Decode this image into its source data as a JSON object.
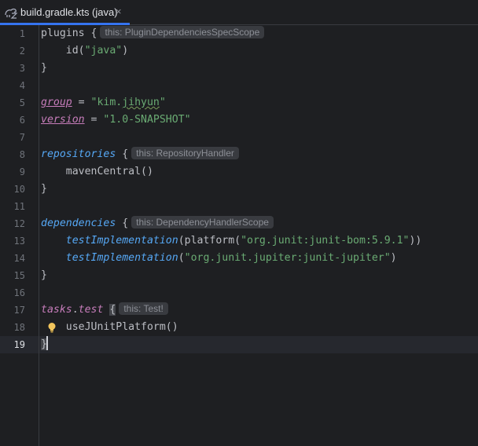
{
  "tab": {
    "label": "build.gradle.kts (java)",
    "close": "×"
  },
  "lines": [
    {
      "n": "1"
    },
    {
      "n": "2"
    },
    {
      "n": "3"
    },
    {
      "n": "4"
    },
    {
      "n": "5"
    },
    {
      "n": "6"
    },
    {
      "n": "7"
    },
    {
      "n": "8"
    },
    {
      "n": "9"
    },
    {
      "n": "10"
    },
    {
      "n": "11"
    },
    {
      "n": "12"
    },
    {
      "n": "13"
    },
    {
      "n": "14"
    },
    {
      "n": "15"
    },
    {
      "n": "16"
    },
    {
      "n": "17"
    },
    {
      "n": "18"
    },
    {
      "n": "19"
    }
  ],
  "code": {
    "l1_plugins": "plugins",
    "l1_brace": " {",
    "l1_hint": "this: PluginDependenciesSpecScope",
    "l2_id": "    id(",
    "l2_str": "\"java\"",
    "l2_close": ")",
    "l3": "}",
    "l5_group": "group",
    "l5_eq": " = ",
    "l5_str_a": "\"kim.",
    "l5_str_b": "jihyun",
    "l5_str_c": "\"",
    "l6_version": "version",
    "l6_eq": " = ",
    "l6_str": "\"1.0-SNAPSHOT\"",
    "l8_repos": "repositories",
    "l8_brace": " {",
    "l8_hint": "this: RepositoryHandler",
    "l9": "    mavenCentral()",
    "l10": "}",
    "l12_deps": "dependencies",
    "l12_brace": " {",
    "l12_hint": "this: DependencyHandlerScope",
    "l13_indent": "    ",
    "l13_fn": "testImplementation",
    "l13_a": "(platform(",
    "l13_str": "\"org.junit:junit-bom:5.9.1\"",
    "l13_b": "))",
    "l14_indent": "    ",
    "l14_fn": "testImplementation",
    "l14_a": "(",
    "l14_str": "\"org.junit.jupiter:junit-jupiter\"",
    "l14_b": ")",
    "l15": "}",
    "l17_tasks": "tasks",
    "l17_dot": ".",
    "l17_test": "test",
    "l17_brace": "{",
    "l17_hint": "this: Test!",
    "l18": "    useJUnitPlatform()",
    "l19": "}"
  }
}
